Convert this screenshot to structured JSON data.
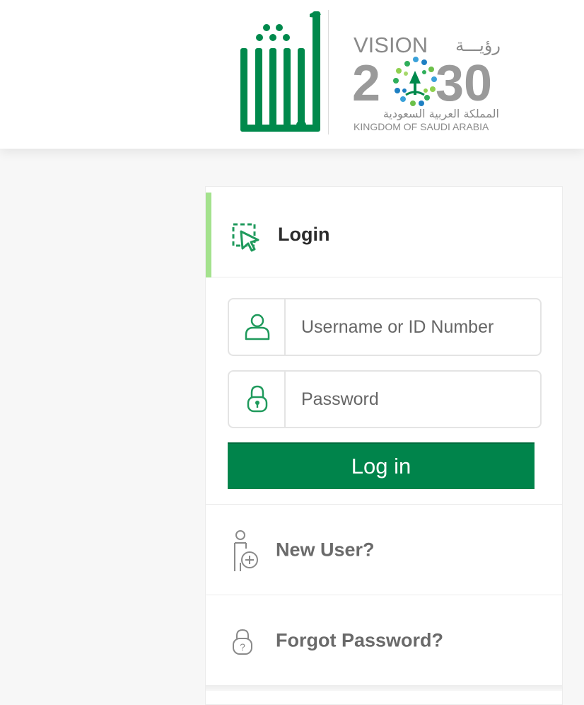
{
  "header": {
    "absher_logo": "absher-logo",
    "vision_logo": {
      "vision_text": "VISION",
      "arabic_vision": "رؤيـــة",
      "year_digit_2": "2",
      "year_digits_30": "30",
      "kingdom_arabic": "المملكة العربية السعودية",
      "kingdom_english": "KINGDOM OF SAUDI ARABIA"
    }
  },
  "login": {
    "title": "Login",
    "title_icon": "cursor-select-icon",
    "username_placeholder": "Username or ID Number",
    "username_value": "",
    "password_placeholder": "Password",
    "password_value": "",
    "submit_label": "Log in"
  },
  "links": {
    "new_user": "New User?",
    "forgot_password": "Forgot Password?"
  },
  "colors": {
    "brand_green": "#00844b",
    "accent_green": "#a4e28d",
    "icon_green": "#1f9a5c"
  }
}
